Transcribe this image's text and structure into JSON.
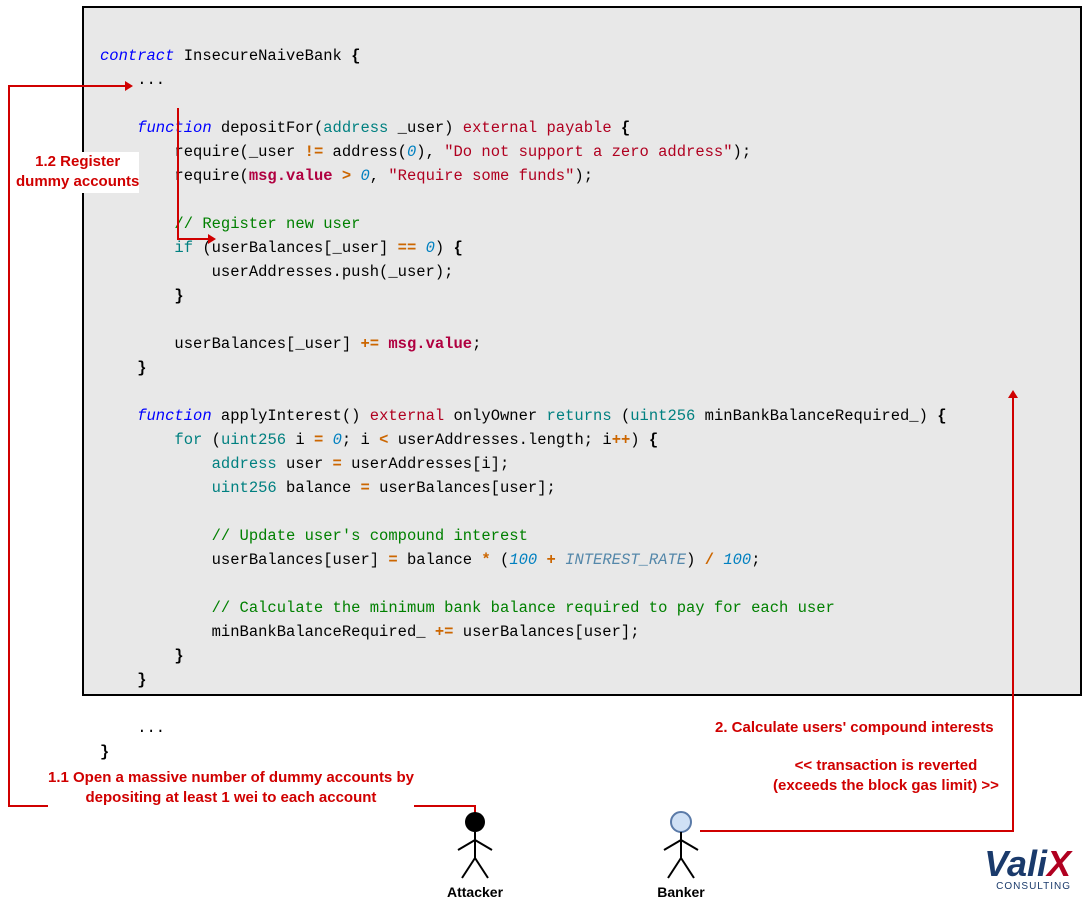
{
  "code": {
    "l1a": "contract",
    "l1b": " InsecureNaiveBank ",
    "l1c": "{",
    "l2": "    ...",
    "l4a": "    function",
    "l4b": " depositFor(",
    "l4c": "address",
    "l4d": " _user) ",
    "l4e": "external payable",
    "l4f": " {",
    "l5a": "        require(_user ",
    "l5b": "!=",
    "l5c": " address(",
    "l5d": "0",
    "l5e": "), ",
    "l5f": "\"Do not support a zero address\"",
    "l5g": ");",
    "l6a": "        require(",
    "l6b": "msg.value",
    "l6c": " > ",
    "l6d": "0",
    "l6e": ", ",
    "l6f": "\"Require some funds\"",
    "l6g": ");",
    "l8": "        // Register new user",
    "l9a": "        if",
    "l9b": " (userBalances[_user] ",
    "l9c": "==",
    "l9d": " ",
    "l9e": "0",
    "l9f": ") ",
    "l9g": "{",
    "l10": "            userAddresses.push(_user);",
    "l11": "        }",
    "l13a": "        userBalances[_user] ",
    "l13b": "+=",
    "l13c": " ",
    "l13d": "msg.value",
    "l13e": ";",
    "l14": "    }",
    "l16a": "    function",
    "l16b": " applyInterest() ",
    "l16c": "external",
    "l16d": " onlyOwner ",
    "l16e": "returns",
    "l16f": " (",
    "l16g": "uint256",
    "l16h": " minBankBalanceRequired_) ",
    "l16i": "{",
    "l17a": "        for",
    "l17b": " (",
    "l17c": "uint256",
    "l17d": " i ",
    "l17e": "=",
    "l17f": " ",
    "l17g": "0",
    "l17h": "; i ",
    "l17i": "<",
    "l17j": " userAddresses.length; i",
    "l17k": "++",
    "l17l": ") ",
    "l17m": "{",
    "l18a": "            address",
    "l18b": " user ",
    "l18c": "=",
    "l18d": " userAddresses[i];",
    "l19a": "            uint256",
    "l19b": " balance ",
    "l19c": "=",
    "l19d": " userBalances[user];",
    "l21": "            // Update user's compound interest",
    "l22a": "            userBalances[user] ",
    "l22b": "=",
    "l22c": " balance ",
    "l22d": "*",
    "l22e": " (",
    "l22f": "100",
    "l22g": " ",
    "l22h": "+",
    "l22i": " ",
    "l22j": "INTEREST_RATE",
    "l22k": ") ",
    "l22l": "/",
    "l22m": " ",
    "l22n": "100",
    "l22o": ";",
    "l24": "            // Calculate the minimum bank balance required to pay for each user",
    "l25a": "            minBankBalanceRequired_ ",
    "l25b": "+=",
    "l25c": " userBalances[user];",
    "l26": "        }",
    "l27": "    }",
    "l29": "    ...",
    "l30": "}"
  },
  "annotations": {
    "a12": "1.2 Register\ndummy accounts",
    "a11": "1.1 Open a massive number of dummy accounts by\ndepositing at least 1 wei to each account",
    "a2": "2. Calculate users' compound interests",
    "arevert": "<< transaction is reverted\n(exceeds the block gas limit) >>"
  },
  "actors": {
    "attacker": "Attacker",
    "banker": "Banker"
  },
  "logo": {
    "name": "Vali",
    "x": "X",
    "sub": "CONSULTING"
  }
}
